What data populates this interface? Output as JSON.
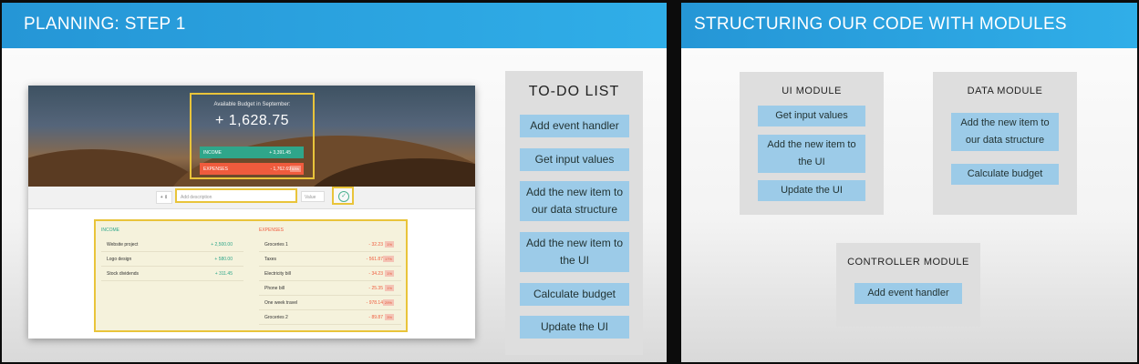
{
  "left_slide": {
    "title": "PLANNING: STEP 1",
    "mock": {
      "budget_label": "Available Budget in September:",
      "budget_value": "+ 1,628.75",
      "income_label": "INCOME",
      "income_value": "+ 3,391.45",
      "expenses_label": "EXPENSES",
      "expenses_value": "- 1,762.69",
      "expenses_percent": "53%",
      "type_select": "+",
      "description_placeholder": "Add description",
      "value_placeholder": "Value",
      "income_title": "INCOME",
      "expenses_title": "EXPENSES",
      "income_items": [
        {
          "name": "Website project",
          "value": "+ 2,500.00"
        },
        {
          "name": "Logo design",
          "value": "+ 580.00"
        },
        {
          "name": "Stock dividends",
          "value": "+ 311.45"
        }
      ],
      "expense_items": [
        {
          "name": "Groceries 1",
          "value": "- 32.23",
          "percent": "1%"
        },
        {
          "name": "Taxes",
          "value": "- 561.87",
          "percent": "17%"
        },
        {
          "name": "Electricity bill",
          "value": "- 34.23",
          "percent": "1%"
        },
        {
          "name": "Phone bill",
          "value": "- 25.35",
          "percent": "1%"
        },
        {
          "name": "One week travel",
          "value": "- 978.14",
          "percent": "29%"
        },
        {
          "name": "Groceries 2",
          "value": "- 89.87",
          "percent": "3%"
        }
      ]
    },
    "todo": {
      "title": "TO-DO LIST",
      "items": [
        "Add event handler",
        "Get input values",
        "Add the new item to our data structure",
        "Add the new item to the UI",
        "Calculate budget",
        "Update the UI"
      ]
    }
  },
  "right_slide": {
    "title": "STRUCTURING OUR CODE WITH MODULES",
    "ui_module": {
      "title": "UI MODULE",
      "items": [
        "Get input values",
        "Add the new item to the UI",
        "Update the UI"
      ]
    },
    "data_module": {
      "title": "DATA MODULE",
      "items": [
        "Add the new item to our data structure",
        "Calculate budget"
      ]
    },
    "controller_module": {
      "title": "CONTROLLER MODULE",
      "items": [
        "Add event handler"
      ]
    }
  },
  "colors": {
    "header_blue": "#2596d6",
    "button_blue": "#9ccbe8",
    "panel_gray": "#dedede",
    "highlight_yellow": "#e9c43a",
    "income_green": "#2fa68a",
    "expense_red": "#ef5b3d"
  }
}
